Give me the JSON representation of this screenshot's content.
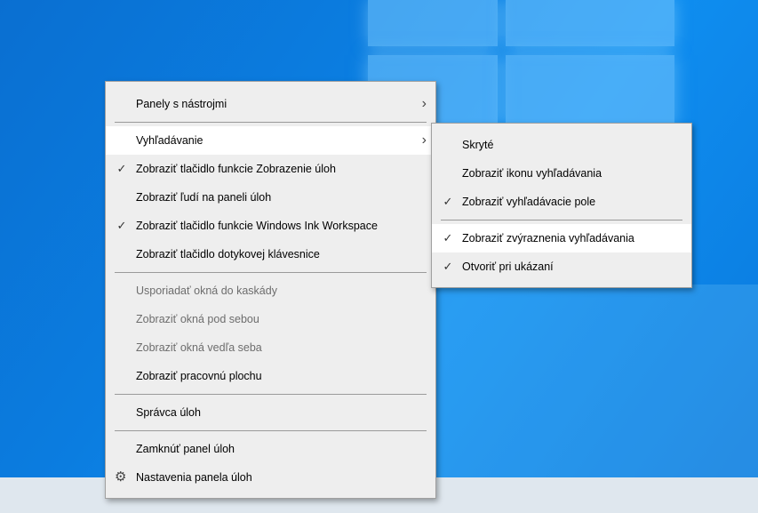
{
  "main_menu": {
    "items": [
      {
        "label": "Panely s nástrojmi",
        "submenu_arrow": "›"
      },
      {
        "label": "Vyhľadávanie",
        "submenu_arrow": "›"
      },
      {
        "label": "Zobraziť tlačidlo funkcie Zobrazenie úloh",
        "check": "✓"
      },
      {
        "label": "Zobraziť ľudí na paneli úloh"
      },
      {
        "label": "Zobraziť tlačidlo funkcie Windows Ink Workspace",
        "check": "✓"
      },
      {
        "label": "Zobraziť tlačidlo dotykovej klávesnice"
      },
      {
        "label": "Usporiadať okná do kaskády"
      },
      {
        "label": "Zobraziť okná pod sebou"
      },
      {
        "label": "Zobraziť okná vedľa seba"
      },
      {
        "label": "Zobraziť pracovnú plochu"
      },
      {
        "label": "Správca úloh"
      },
      {
        "label": "Zamknúť panel úloh"
      },
      {
        "label": "Nastavenia panela úloh",
        "icon": "gear-icon",
        "icon_glyph": "⚙"
      }
    ]
  },
  "search_submenu": {
    "items": [
      {
        "label": "Skryté"
      },
      {
        "label": "Zobraziť ikonu vyhľadávania"
      },
      {
        "label": "Zobraziť vyhľadávacie pole",
        "check": "✓"
      },
      {
        "label": "Zobraziť zvýraznenia vyhľadávania",
        "check": "✓"
      },
      {
        "label": "Otvoriť pri ukázaní",
        "check": "✓"
      }
    ]
  },
  "colors": {
    "menu_background": "#eeeeee",
    "hover_background": "#ffffff",
    "disabled_text": "#6d6d6d",
    "desktop_blue": "#0b7de0"
  }
}
